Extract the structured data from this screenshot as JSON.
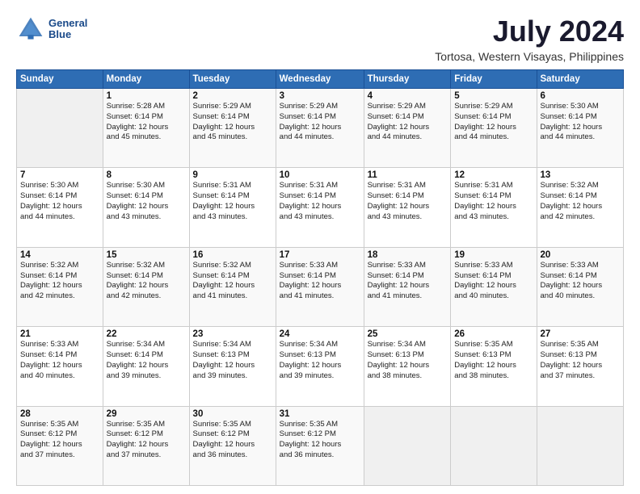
{
  "header": {
    "logo_line1": "General",
    "logo_line2": "Blue",
    "main_title": "July 2024",
    "subtitle": "Tortosa, Western Visayas, Philippines"
  },
  "days_of_week": [
    "Sunday",
    "Monday",
    "Tuesday",
    "Wednesday",
    "Thursday",
    "Friday",
    "Saturday"
  ],
  "weeks": [
    [
      {
        "day": "",
        "info": ""
      },
      {
        "day": "1",
        "info": "Sunrise: 5:28 AM\nSunset: 6:14 PM\nDaylight: 12 hours\nand 45 minutes."
      },
      {
        "day": "2",
        "info": "Sunrise: 5:29 AM\nSunset: 6:14 PM\nDaylight: 12 hours\nand 45 minutes."
      },
      {
        "day": "3",
        "info": "Sunrise: 5:29 AM\nSunset: 6:14 PM\nDaylight: 12 hours\nand 44 minutes."
      },
      {
        "day": "4",
        "info": "Sunrise: 5:29 AM\nSunset: 6:14 PM\nDaylight: 12 hours\nand 44 minutes."
      },
      {
        "day": "5",
        "info": "Sunrise: 5:29 AM\nSunset: 6:14 PM\nDaylight: 12 hours\nand 44 minutes."
      },
      {
        "day": "6",
        "info": "Sunrise: 5:30 AM\nSunset: 6:14 PM\nDaylight: 12 hours\nand 44 minutes."
      }
    ],
    [
      {
        "day": "7",
        "info": "Sunrise: 5:30 AM\nSunset: 6:14 PM\nDaylight: 12 hours\nand 44 minutes."
      },
      {
        "day": "8",
        "info": "Sunrise: 5:30 AM\nSunset: 6:14 PM\nDaylight: 12 hours\nand 43 minutes."
      },
      {
        "day": "9",
        "info": "Sunrise: 5:31 AM\nSunset: 6:14 PM\nDaylight: 12 hours\nand 43 minutes."
      },
      {
        "day": "10",
        "info": "Sunrise: 5:31 AM\nSunset: 6:14 PM\nDaylight: 12 hours\nand 43 minutes."
      },
      {
        "day": "11",
        "info": "Sunrise: 5:31 AM\nSunset: 6:14 PM\nDaylight: 12 hours\nand 43 minutes."
      },
      {
        "day": "12",
        "info": "Sunrise: 5:31 AM\nSunset: 6:14 PM\nDaylight: 12 hours\nand 43 minutes."
      },
      {
        "day": "13",
        "info": "Sunrise: 5:32 AM\nSunset: 6:14 PM\nDaylight: 12 hours\nand 42 minutes."
      }
    ],
    [
      {
        "day": "14",
        "info": "Sunrise: 5:32 AM\nSunset: 6:14 PM\nDaylight: 12 hours\nand 42 minutes."
      },
      {
        "day": "15",
        "info": "Sunrise: 5:32 AM\nSunset: 6:14 PM\nDaylight: 12 hours\nand 42 minutes."
      },
      {
        "day": "16",
        "info": "Sunrise: 5:32 AM\nSunset: 6:14 PM\nDaylight: 12 hours\nand 41 minutes."
      },
      {
        "day": "17",
        "info": "Sunrise: 5:33 AM\nSunset: 6:14 PM\nDaylight: 12 hours\nand 41 minutes."
      },
      {
        "day": "18",
        "info": "Sunrise: 5:33 AM\nSunset: 6:14 PM\nDaylight: 12 hours\nand 41 minutes."
      },
      {
        "day": "19",
        "info": "Sunrise: 5:33 AM\nSunset: 6:14 PM\nDaylight: 12 hours\nand 40 minutes."
      },
      {
        "day": "20",
        "info": "Sunrise: 5:33 AM\nSunset: 6:14 PM\nDaylight: 12 hours\nand 40 minutes."
      }
    ],
    [
      {
        "day": "21",
        "info": "Sunrise: 5:33 AM\nSunset: 6:14 PM\nDaylight: 12 hours\nand 40 minutes."
      },
      {
        "day": "22",
        "info": "Sunrise: 5:34 AM\nSunset: 6:14 PM\nDaylight: 12 hours\nand 39 minutes."
      },
      {
        "day": "23",
        "info": "Sunrise: 5:34 AM\nSunset: 6:13 PM\nDaylight: 12 hours\nand 39 minutes."
      },
      {
        "day": "24",
        "info": "Sunrise: 5:34 AM\nSunset: 6:13 PM\nDaylight: 12 hours\nand 39 minutes."
      },
      {
        "day": "25",
        "info": "Sunrise: 5:34 AM\nSunset: 6:13 PM\nDaylight: 12 hours\nand 38 minutes."
      },
      {
        "day": "26",
        "info": "Sunrise: 5:35 AM\nSunset: 6:13 PM\nDaylight: 12 hours\nand 38 minutes."
      },
      {
        "day": "27",
        "info": "Sunrise: 5:35 AM\nSunset: 6:13 PM\nDaylight: 12 hours\nand 37 minutes."
      }
    ],
    [
      {
        "day": "28",
        "info": "Sunrise: 5:35 AM\nSunset: 6:12 PM\nDaylight: 12 hours\nand 37 minutes."
      },
      {
        "day": "29",
        "info": "Sunrise: 5:35 AM\nSunset: 6:12 PM\nDaylight: 12 hours\nand 37 minutes."
      },
      {
        "day": "30",
        "info": "Sunrise: 5:35 AM\nSunset: 6:12 PM\nDaylight: 12 hours\nand 36 minutes."
      },
      {
        "day": "31",
        "info": "Sunrise: 5:35 AM\nSunset: 6:12 PM\nDaylight: 12 hours\nand 36 minutes."
      },
      {
        "day": "",
        "info": ""
      },
      {
        "day": "",
        "info": ""
      },
      {
        "day": "",
        "info": ""
      }
    ]
  ]
}
